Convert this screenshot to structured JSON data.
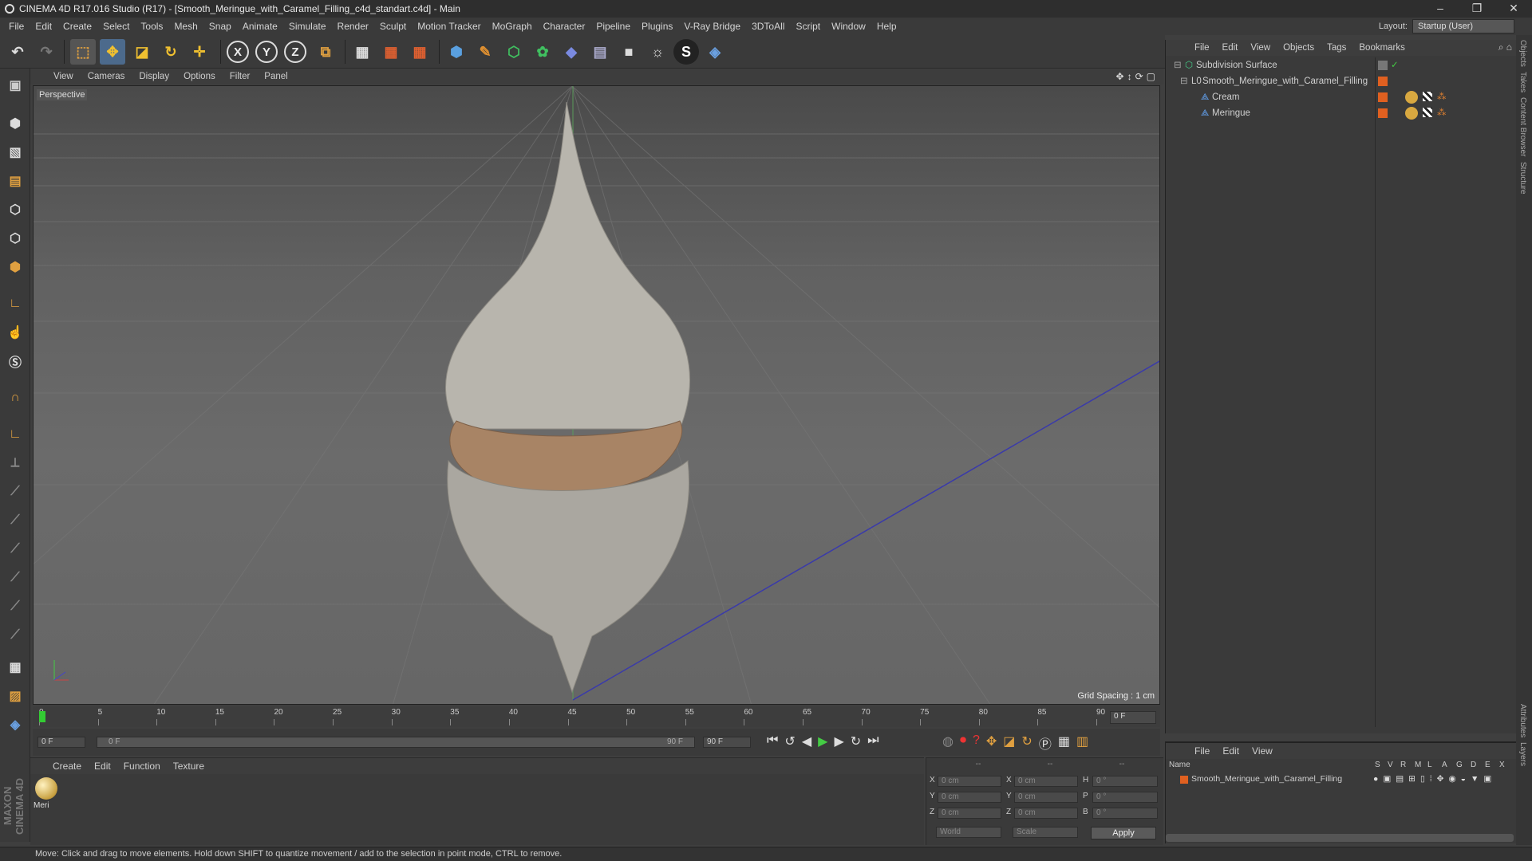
{
  "window": {
    "title": "CINEMA 4D R17.016 Studio (R17) - [Smooth_Meringue_with_Caramel_Filling_c4d_standart.c4d] - Main",
    "controls": [
      "–",
      "❐",
      "✕"
    ]
  },
  "menubar": [
    "File",
    "Edit",
    "Create",
    "Select",
    "Tools",
    "Mesh",
    "Snap",
    "Animate",
    "Simulate",
    "Render",
    "Sculpt",
    "Motion Tracker",
    "MoGraph",
    "Character",
    "Pipeline",
    "Plugins",
    "V-Ray Bridge",
    "3DToAll",
    "Script",
    "Window",
    "Help"
  ],
  "layout": {
    "label": "Layout:",
    "value": "Startup (User)"
  },
  "toolbar": {
    "axis_x": "X",
    "axis_y": "Y",
    "axis_z": "Z"
  },
  "viewport": {
    "menu": [
      "View",
      "Cameras",
      "Display",
      "Options",
      "Filter",
      "Panel"
    ],
    "label": "Perspective",
    "grid_spacing": "Grid Spacing : 1 cm"
  },
  "timeline": {
    "ticks": [
      "0",
      "5",
      "10",
      "15",
      "20",
      "25",
      "30",
      "35",
      "40",
      "45",
      "50",
      "55",
      "60",
      "65",
      "70",
      "75",
      "80",
      "85",
      "90"
    ],
    "current_frame": "0 F"
  },
  "transport": {
    "start": "0 F",
    "slider_start": "0 F",
    "slider_end": "90 F",
    "end": "90 F"
  },
  "material_manager": {
    "menu": [
      "Create",
      "Edit",
      "Function",
      "Texture"
    ],
    "material_name": "Meri"
  },
  "coordinates": {
    "header": [
      "--",
      "--",
      "--"
    ],
    "rows": [
      {
        "a": "X",
        "av": "0 cm",
        "b": "X",
        "bv": "0 cm",
        "c": "H",
        "cv": "0 °"
      },
      {
        "a": "Y",
        "av": "0 cm",
        "b": "Y",
        "bv": "0 cm",
        "c": "P",
        "cv": "0 °"
      },
      {
        "a": "Z",
        "av": "0 cm",
        "b": "Z",
        "bv": "0 cm",
        "c": "B",
        "cv": "0 °"
      }
    ],
    "world": "World",
    "scale": "Scale",
    "apply": "Apply"
  },
  "object_manager": {
    "menu": [
      "File",
      "Edit",
      "View",
      "Objects",
      "Tags",
      "Bookmarks"
    ],
    "objects": [
      {
        "name": "Subdivision Surface"
      },
      {
        "name": "Smooth_Meringue_with_Caramel_Filling"
      },
      {
        "name": "Cream"
      },
      {
        "name": "Meringue"
      }
    ]
  },
  "layer_manager": {
    "menu": [
      "File",
      "Edit",
      "View"
    ],
    "columns": [
      "Name",
      "S",
      "V",
      "R",
      "M",
      "L",
      "A",
      "G",
      "D",
      "E",
      "X"
    ],
    "row": "Smooth_Meringue_with_Caramel_Filling"
  },
  "side_tabs": [
    "Objects",
    "Takes",
    "Content Browser",
    "Structure",
    "Attributes",
    "Layers"
  ],
  "branding": "MAXON CINEMA 4D",
  "status": "Move: Click and drag to move elements. Hold down SHIFT to quantize movement / add to the selection in point mode, CTRL to remove."
}
